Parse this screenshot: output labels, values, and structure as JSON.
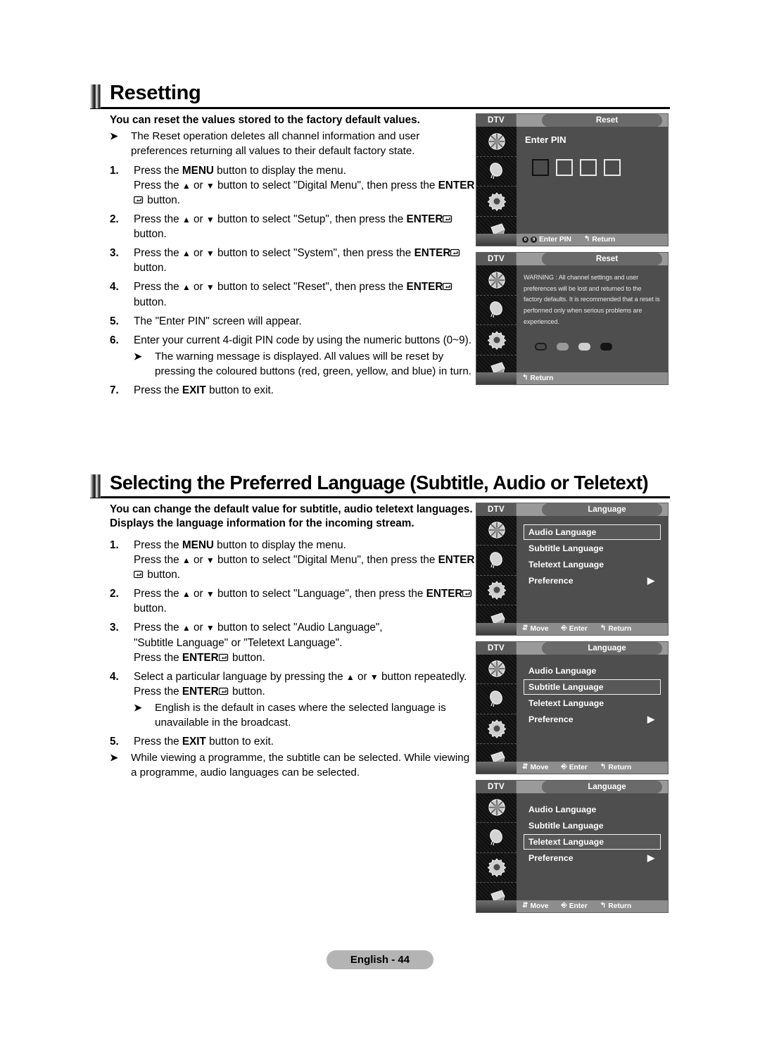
{
  "sections": [
    {
      "id": "reset",
      "heading": "Resetting",
      "lead": "You can reset the values stored to the factory default values.",
      "intro_note": "The Reset operation deletes all channel information and user preferences returning all values to their default factory state.",
      "steps": [
        {
          "num": "1.",
          "lines": [
            "Press the MENU button to display the menu.",
            "Press the ▲ or ▼ button to select \"Digital Menu\", then press the ENTER button."
          ]
        },
        {
          "num": "2.",
          "lines": [
            "Press the ▲ or ▼ button to select \"Setup\", then press the ENTER button."
          ]
        },
        {
          "num": "3.",
          "lines": [
            "Press the ▲ or ▼ button to select \"System\", then press the ENTER button."
          ]
        },
        {
          "num": "4.",
          "lines": [
            "Press the ▲ or ▼ button to select \"Reset\", then press the ENTER button."
          ]
        },
        {
          "num": "5.",
          "lines": [
            "The \"Enter PIN\" screen will appear."
          ]
        },
        {
          "num": "6.",
          "lines": [
            "Enter your current 4-digit PIN code by using the numeric buttons (0~9)."
          ],
          "note": "The warning message is displayed. All values will be reset by pressing the coloured buttons (red, green, yellow, and blue) in turn."
        },
        {
          "num": "7.",
          "lines": [
            "Press the EXIT button to exit."
          ]
        }
      ]
    },
    {
      "id": "language",
      "heading": "Selecting the Preferred Language (Subtitle, Audio or Teletext)",
      "lead": "You can change the default value for subtitle, audio teletext languages.",
      "lead2": "Displays the language information for the incoming stream.",
      "steps": [
        {
          "num": "1.",
          "lines": [
            "Press the MENU button to display the menu.",
            "Press the ▲ or ▼ button to select \"Digital Menu\", then press the ENTER button."
          ]
        },
        {
          "num": "2.",
          "lines": [
            "Press the ▲ or ▼ button to select \"Language\", then press the ENTER button."
          ]
        },
        {
          "num": "3.",
          "lines": [
            "Press the ▲ or ▼ button to select \"Audio Language\", \"Subtitle Language\" or \"Teletext Language\".",
            "Press the ENTER button."
          ]
        },
        {
          "num": "4.",
          "lines": [
            "Select a particular language by pressing the ▲ or ▼ button repeatedly.",
            "Press the ENTER button."
          ],
          "note": "English is the default in cases where the selected language is unavailable in the broadcast."
        },
        {
          "num": "5.",
          "lines": [
            "Press the EXIT button to exit."
          ]
        }
      ],
      "closing_note": "While viewing a programme, the subtitle can be selected. While viewing a programme, audio languages can be selected."
    }
  ],
  "screens": {
    "pin": {
      "source_label": "DTV",
      "title": "Reset",
      "prompt": "Enter PIN",
      "pin_boxes": 4,
      "active_box_index": 0,
      "bottom": [
        {
          "key": "0~9",
          "label": "Enter PIN"
        },
        {
          "key": "return",
          "label": "Return"
        }
      ]
    },
    "warning": {
      "source_label": "DTV",
      "title": "Reset",
      "message": "WARNING : All channel settings and user preferences will be lost and returned to the factory defaults. It is recommended that a reset is performed only when serious problems are experienced.",
      "colour_buttons": [
        "red",
        "green",
        "yellow",
        "blue"
      ],
      "bottom": [
        {
          "key": "return",
          "label": "Return"
        }
      ]
    },
    "language_audio": {
      "source_label": "DTV",
      "title": "Language",
      "items": [
        {
          "label": "Audio Language",
          "selected": true,
          "arrow": ""
        },
        {
          "label": "Subtitle Language",
          "selected": false,
          "arrow": ""
        },
        {
          "label": "Teletext Language",
          "selected": false,
          "arrow": ""
        },
        {
          "label": "Preference",
          "selected": false,
          "arrow": "▶"
        }
      ],
      "bottom": [
        {
          "key": "move",
          "label": "Move"
        },
        {
          "key": "enter",
          "label": "Enter"
        },
        {
          "key": "return",
          "label": "Return"
        }
      ]
    },
    "language_subtitle": {
      "source_label": "DTV",
      "title": "Language",
      "items": [
        {
          "label": "Audio Language",
          "selected": false,
          "arrow": ""
        },
        {
          "label": "Subtitle Language",
          "selected": true,
          "arrow": ""
        },
        {
          "label": "Teletext Language",
          "selected": false,
          "arrow": ""
        },
        {
          "label": "Preference",
          "selected": false,
          "arrow": "▶"
        }
      ],
      "bottom": [
        {
          "key": "move",
          "label": "Move"
        },
        {
          "key": "enter",
          "label": "Enter"
        },
        {
          "key": "return",
          "label": "Return"
        }
      ]
    },
    "language_teletext": {
      "source_label": "DTV",
      "title": "Language",
      "items": [
        {
          "label": "Audio Language",
          "selected": false,
          "arrow": ""
        },
        {
          "label": "Subtitle Language",
          "selected": false,
          "arrow": ""
        },
        {
          "label": "Teletext Language",
          "selected": true,
          "arrow": ""
        },
        {
          "label": "Preference",
          "selected": false,
          "arrow": "▶"
        }
      ],
      "bottom": [
        {
          "key": "move",
          "label": "Move"
        },
        {
          "key": "enter",
          "label": "Enter"
        },
        {
          "key": "return",
          "label": "Return"
        }
      ]
    },
    "rail_icons": [
      "picture-icon",
      "sound-icon",
      "setup-icon",
      "input-icon"
    ]
  },
  "footer": {
    "label": "English - 44"
  },
  "colors": {
    "page_bg": "#ffffff",
    "screen_bg": "#4e4e4e",
    "footer_pill": "#b4b4b4"
  }
}
